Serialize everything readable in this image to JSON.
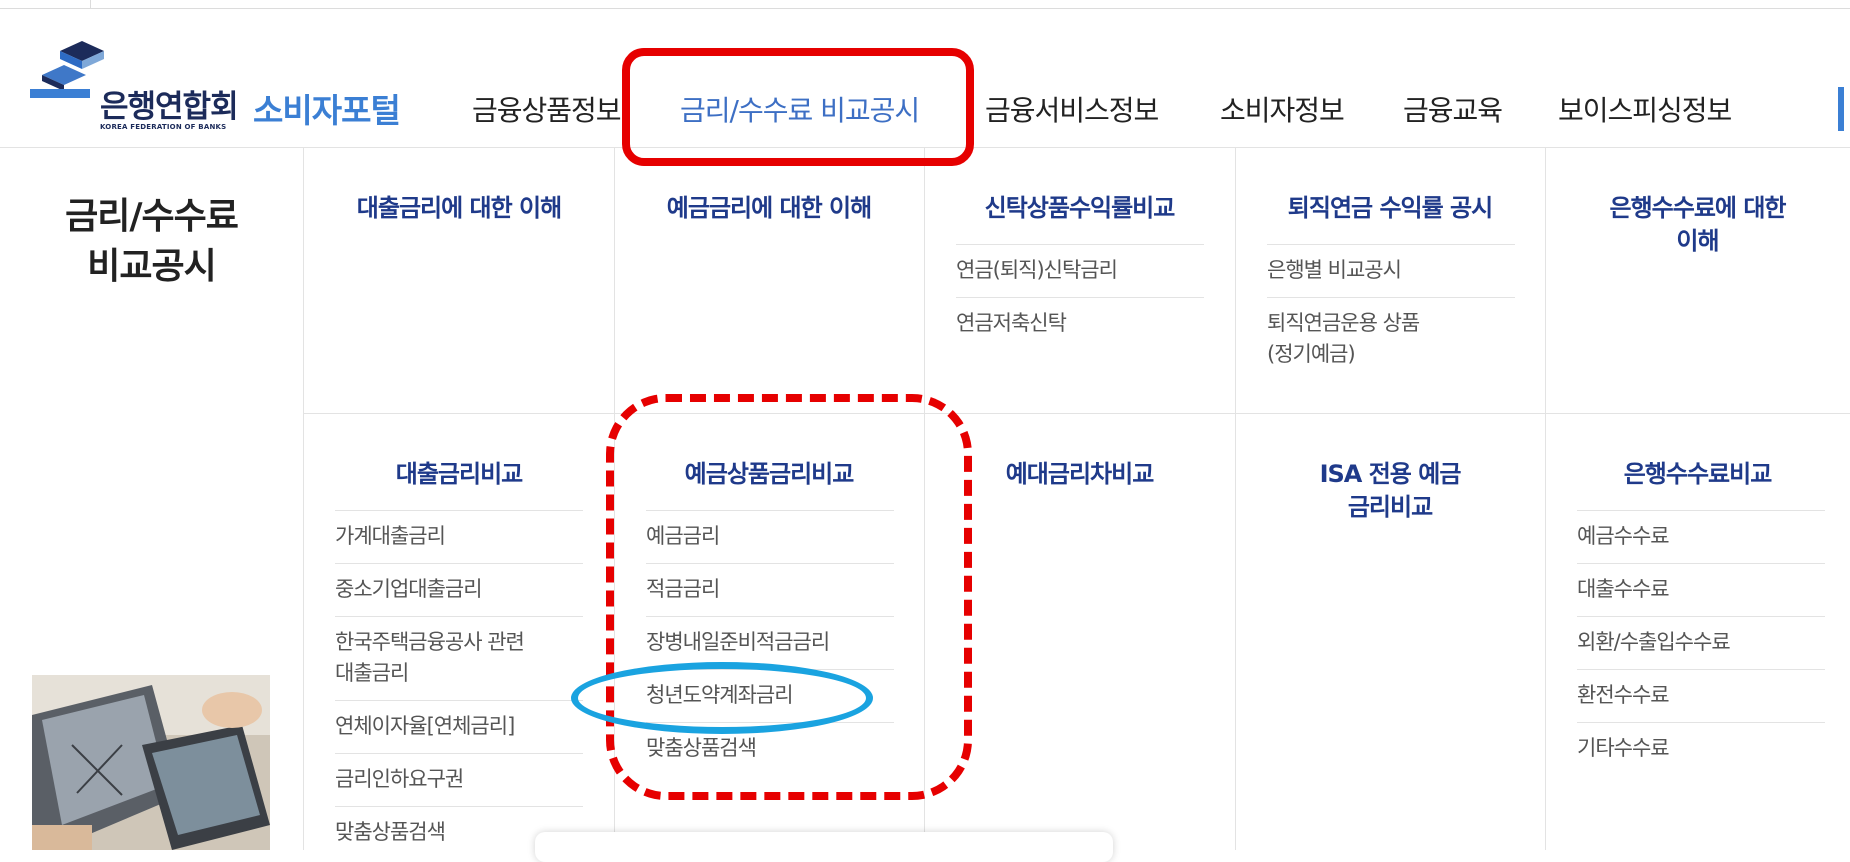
{
  "logo": {
    "ko": "은행연합회",
    "en": "KOREA FEDERATION OF BANKS",
    "portal": "소비자포털"
  },
  "gnb": [
    "금융상품정보",
    "금리/수수료 비교공시",
    "금융서비스정보",
    "소비자정보",
    "금융교육",
    "보이스피싱정보"
  ],
  "side": {
    "title_line1": "금리/수수료",
    "title_line2": "비교공시"
  },
  "row1": [
    {
      "title": "대출금리에 대한 이해",
      "items": []
    },
    {
      "title": "예금금리에 대한 이해",
      "items": []
    },
    {
      "title": "신탁상품수익률비교",
      "items": [
        "연금(퇴직)신탁금리",
        "연금저축신탁"
      ]
    },
    {
      "title": "퇴직연금 수익률 공시",
      "items": [
        "은행별 비교공시",
        "퇴직연금운용 상품",
        "(정기예금)"
      ]
    },
    {
      "title": "은행수수료에 대한",
      "title2": "이해",
      "items": []
    }
  ],
  "row2": [
    {
      "title": "대출금리비교",
      "items": [
        "가계대출금리",
        "중소기업대출금리",
        "한국주택금융공사 관련",
        "대출금리",
        "연체이자율[연체금리]",
        "금리인하요구권",
        "맞춤상품검색"
      ]
    },
    {
      "title": "예금상품금리비교",
      "items": [
        "예금금리",
        "적금금리",
        "장병내일준비적금금리",
        "청년도약계좌금리",
        "맞춤상품검색"
      ]
    },
    {
      "title": "예대금리차비교",
      "items": []
    },
    {
      "title": "ISA 전용 예금",
      "title2": "금리비교",
      "items": []
    },
    {
      "title": "은행수수료비교",
      "items": [
        "예금수수료",
        "대출수수료",
        "외환/수출입수수료",
        "환전수수료",
        "기타수수료"
      ]
    }
  ],
  "colors": {
    "accent": "#3b7fd4",
    "title_blue": "#1f3a8a",
    "annotation_red": "#e60000",
    "annotation_blue": "#1aa3e0"
  }
}
